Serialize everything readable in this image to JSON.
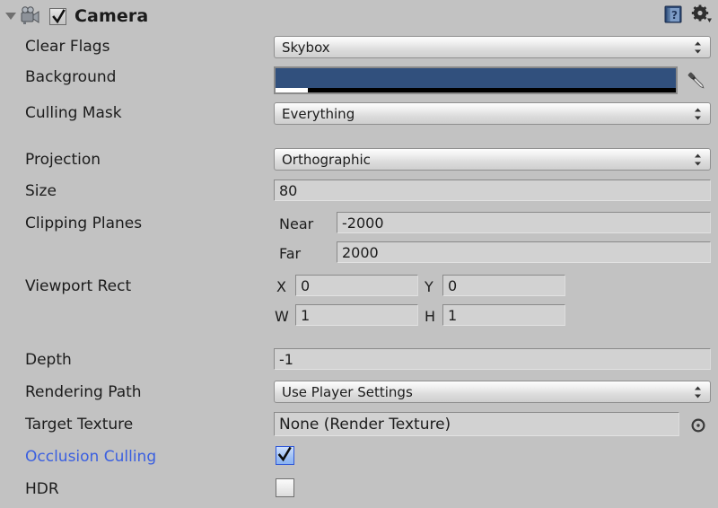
{
  "header": {
    "title": "Camera",
    "enabled": true,
    "foldout_open": true,
    "icon": "camera-icon",
    "help_icon": "help-book-icon",
    "settings_icon": "gear-icon"
  },
  "colors": {
    "panel_background": "#c2c2c2",
    "background_color_value": "#31507d",
    "link_label": "#3a5fe0",
    "checkbox_checked": "#2f57d8"
  },
  "rows": {
    "clear_flags": {
      "label": "Clear Flags",
      "value": "Skybox"
    },
    "background": {
      "label": "Background",
      "color": "#31507d",
      "alpha": 0.08
    },
    "culling_mask": {
      "label": "Culling Mask",
      "value": "Everything"
    },
    "projection": {
      "label": "Projection",
      "value": "Orthographic"
    },
    "size": {
      "label": "Size",
      "value": "80"
    },
    "clipping_planes": {
      "label": "Clipping Planes",
      "near_label": "Near",
      "near_value": "-2000",
      "far_label": "Far",
      "far_value": "2000"
    },
    "viewport_rect": {
      "label": "Viewport Rect",
      "x_label": "X",
      "x_value": "0",
      "y_label": "Y",
      "y_value": "0",
      "w_label": "W",
      "w_value": "1",
      "h_label": "H",
      "h_value": "1"
    },
    "depth": {
      "label": "Depth",
      "value": "-1"
    },
    "rendering_path": {
      "label": "Rendering Path",
      "value": "Use Player Settings"
    },
    "target_texture": {
      "label": "Target Texture",
      "value": "None (Render Texture)",
      "picker_icon": "object-picker-icon"
    },
    "occlusion_culling": {
      "label": "Occlusion Culling",
      "checked": true
    },
    "hdr": {
      "label": "HDR",
      "checked": false
    }
  }
}
